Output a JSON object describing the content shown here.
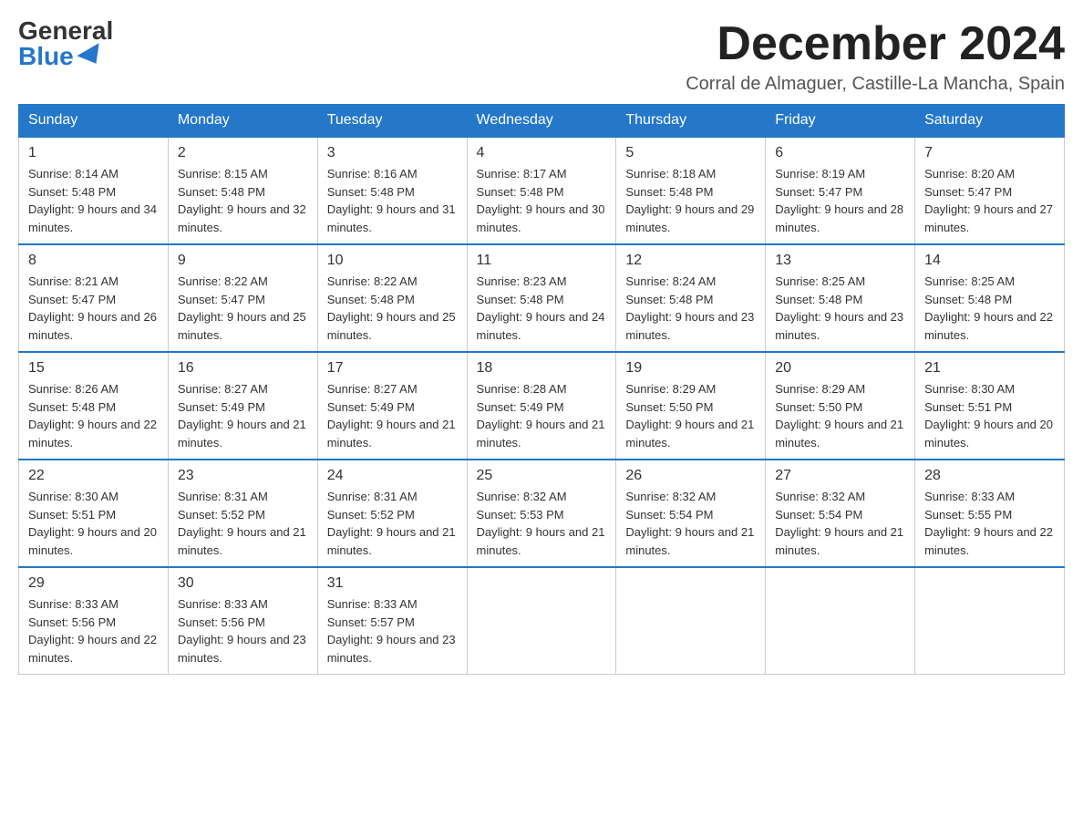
{
  "header": {
    "logo_general": "General",
    "logo_blue": "Blue",
    "month_title": "December 2024",
    "location": "Corral de Almaguer, Castille-La Mancha, Spain"
  },
  "weekdays": [
    "Sunday",
    "Monday",
    "Tuesday",
    "Wednesday",
    "Thursday",
    "Friday",
    "Saturday"
  ],
  "weeks": [
    [
      {
        "day": "1",
        "sunrise": "8:14 AM",
        "sunset": "5:48 PM",
        "daylight": "9 hours and 34 minutes."
      },
      {
        "day": "2",
        "sunrise": "8:15 AM",
        "sunset": "5:48 PM",
        "daylight": "9 hours and 32 minutes."
      },
      {
        "day": "3",
        "sunrise": "8:16 AM",
        "sunset": "5:48 PM",
        "daylight": "9 hours and 31 minutes."
      },
      {
        "day": "4",
        "sunrise": "8:17 AM",
        "sunset": "5:48 PM",
        "daylight": "9 hours and 30 minutes."
      },
      {
        "day": "5",
        "sunrise": "8:18 AM",
        "sunset": "5:48 PM",
        "daylight": "9 hours and 29 minutes."
      },
      {
        "day": "6",
        "sunrise": "8:19 AM",
        "sunset": "5:47 PM",
        "daylight": "9 hours and 28 minutes."
      },
      {
        "day": "7",
        "sunrise": "8:20 AM",
        "sunset": "5:47 PM",
        "daylight": "9 hours and 27 minutes."
      }
    ],
    [
      {
        "day": "8",
        "sunrise": "8:21 AM",
        "sunset": "5:47 PM",
        "daylight": "9 hours and 26 minutes."
      },
      {
        "day": "9",
        "sunrise": "8:22 AM",
        "sunset": "5:47 PM",
        "daylight": "9 hours and 25 minutes."
      },
      {
        "day": "10",
        "sunrise": "8:22 AM",
        "sunset": "5:48 PM",
        "daylight": "9 hours and 25 minutes."
      },
      {
        "day": "11",
        "sunrise": "8:23 AM",
        "sunset": "5:48 PM",
        "daylight": "9 hours and 24 minutes."
      },
      {
        "day": "12",
        "sunrise": "8:24 AM",
        "sunset": "5:48 PM",
        "daylight": "9 hours and 23 minutes."
      },
      {
        "day": "13",
        "sunrise": "8:25 AM",
        "sunset": "5:48 PM",
        "daylight": "9 hours and 23 minutes."
      },
      {
        "day": "14",
        "sunrise": "8:25 AM",
        "sunset": "5:48 PM",
        "daylight": "9 hours and 22 minutes."
      }
    ],
    [
      {
        "day": "15",
        "sunrise": "8:26 AM",
        "sunset": "5:48 PM",
        "daylight": "9 hours and 22 minutes."
      },
      {
        "day": "16",
        "sunrise": "8:27 AM",
        "sunset": "5:49 PM",
        "daylight": "9 hours and 21 minutes."
      },
      {
        "day": "17",
        "sunrise": "8:27 AM",
        "sunset": "5:49 PM",
        "daylight": "9 hours and 21 minutes."
      },
      {
        "day": "18",
        "sunrise": "8:28 AM",
        "sunset": "5:49 PM",
        "daylight": "9 hours and 21 minutes."
      },
      {
        "day": "19",
        "sunrise": "8:29 AM",
        "sunset": "5:50 PM",
        "daylight": "9 hours and 21 minutes."
      },
      {
        "day": "20",
        "sunrise": "8:29 AM",
        "sunset": "5:50 PM",
        "daylight": "9 hours and 21 minutes."
      },
      {
        "day": "21",
        "sunrise": "8:30 AM",
        "sunset": "5:51 PM",
        "daylight": "9 hours and 20 minutes."
      }
    ],
    [
      {
        "day": "22",
        "sunrise": "8:30 AM",
        "sunset": "5:51 PM",
        "daylight": "9 hours and 20 minutes."
      },
      {
        "day": "23",
        "sunrise": "8:31 AM",
        "sunset": "5:52 PM",
        "daylight": "9 hours and 21 minutes."
      },
      {
        "day": "24",
        "sunrise": "8:31 AM",
        "sunset": "5:52 PM",
        "daylight": "9 hours and 21 minutes."
      },
      {
        "day": "25",
        "sunrise": "8:32 AM",
        "sunset": "5:53 PM",
        "daylight": "9 hours and 21 minutes."
      },
      {
        "day": "26",
        "sunrise": "8:32 AM",
        "sunset": "5:54 PM",
        "daylight": "9 hours and 21 minutes."
      },
      {
        "day": "27",
        "sunrise": "8:32 AM",
        "sunset": "5:54 PM",
        "daylight": "9 hours and 21 minutes."
      },
      {
        "day": "28",
        "sunrise": "8:33 AM",
        "sunset": "5:55 PM",
        "daylight": "9 hours and 22 minutes."
      }
    ],
    [
      {
        "day": "29",
        "sunrise": "8:33 AM",
        "sunset": "5:56 PM",
        "daylight": "9 hours and 22 minutes."
      },
      {
        "day": "30",
        "sunrise": "8:33 AM",
        "sunset": "5:56 PM",
        "daylight": "9 hours and 23 minutes."
      },
      {
        "day": "31",
        "sunrise": "8:33 AM",
        "sunset": "5:57 PM",
        "daylight": "9 hours and 23 minutes."
      },
      null,
      null,
      null,
      null
    ]
  ],
  "labels": {
    "sunrise": "Sunrise:",
    "sunset": "Sunset:",
    "daylight": "Daylight:"
  }
}
